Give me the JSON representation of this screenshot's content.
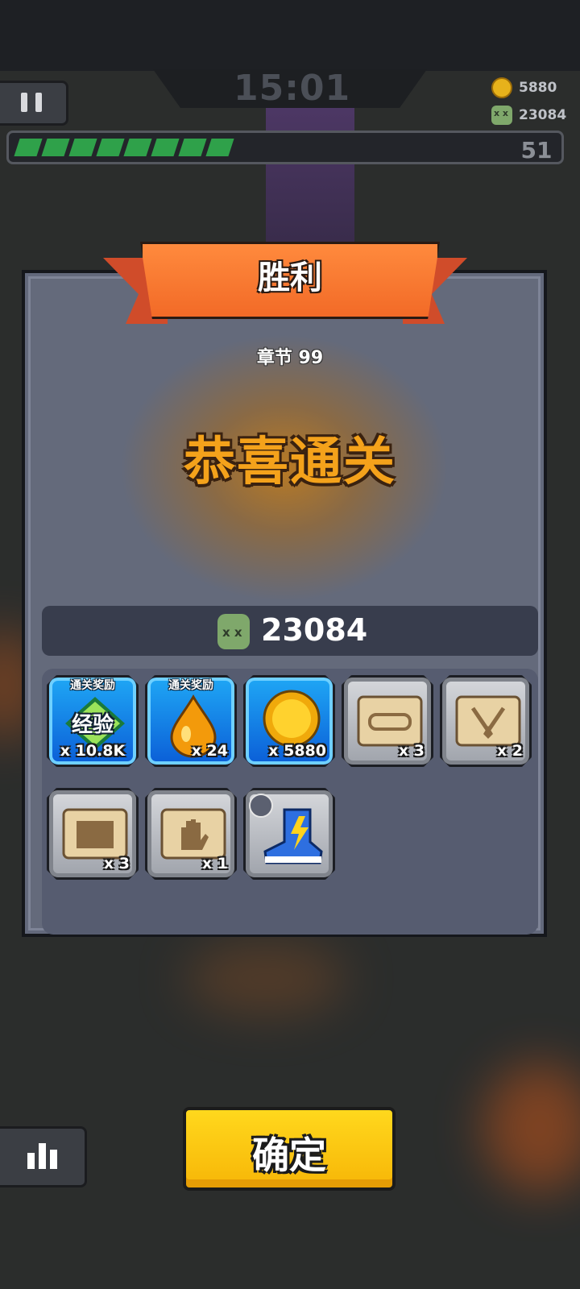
{
  "hud": {
    "timer": "15:01",
    "gold": "5880",
    "kills": "23084",
    "level": "51",
    "xp_progress": 0.45
  },
  "dialog": {
    "title": "胜利",
    "chapter": "章节 99",
    "headline": "恭喜通关",
    "kill_count": "23084",
    "rewards": [
      {
        "icon": "exp-diamond-icon",
        "tag": "通关奖励",
        "label": "经验",
        "qty": "x 10.8K",
        "rarity": "blue"
      },
      {
        "icon": "oil-drop-icon",
        "tag": "通关奖励",
        "qty": "x 24",
        "rarity": "blue"
      },
      {
        "icon": "gold-coin-icon",
        "qty": "x 5880",
        "rarity": "blue"
      },
      {
        "icon": "belt-scroll-icon",
        "qty": "x 3",
        "rarity": "gray"
      },
      {
        "icon": "necklace-scroll-icon",
        "qty": "x 2",
        "rarity": "gray"
      },
      {
        "icon": "armor-scroll-icon",
        "qty": "x 3",
        "rarity": "gray"
      },
      {
        "icon": "glove-scroll-icon",
        "qty": "x 1",
        "rarity": "gray"
      },
      {
        "icon": "lightning-boots-icon",
        "rarity": "blue"
      }
    ]
  },
  "buttons": {
    "confirm": "确定"
  },
  "colors": {
    "ribbon": "#f26a27",
    "headline": "#f4a21b",
    "confirm": "#ffd81d",
    "panel": "#63697c",
    "xp": "#2fa14a"
  }
}
